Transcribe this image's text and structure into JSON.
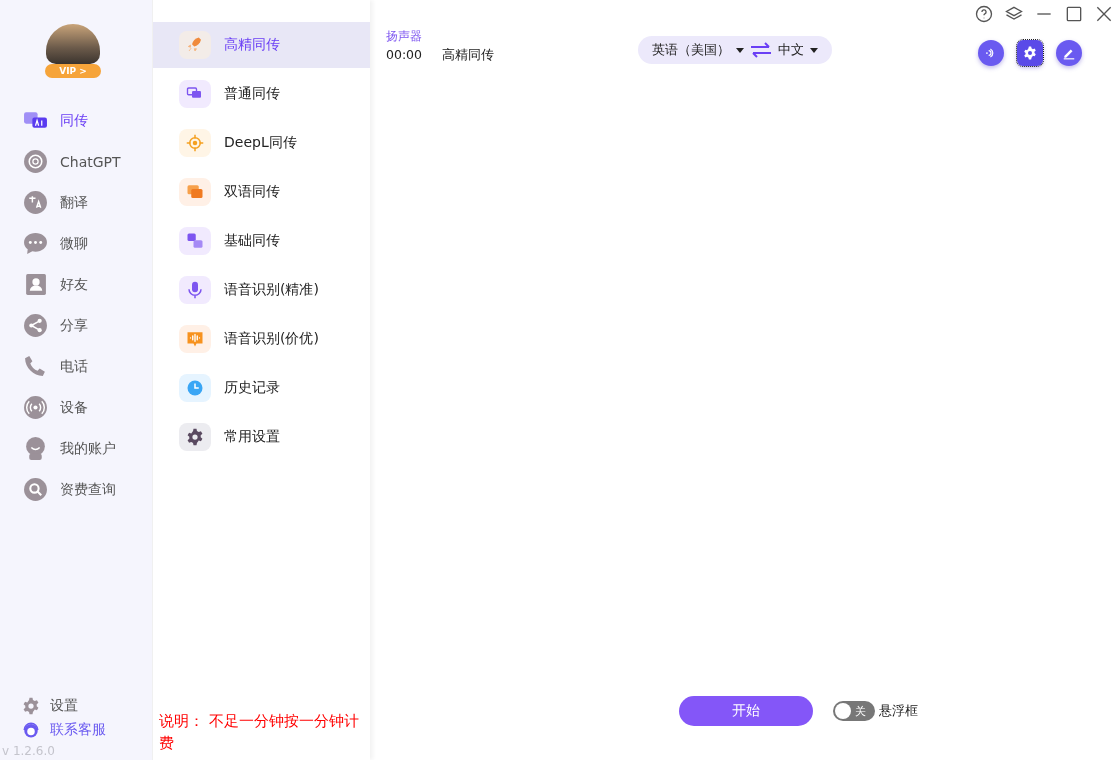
{
  "profile": {
    "badge": "VIP >"
  },
  "nav": {
    "items": [
      {
        "label": "同传",
        "selected": true
      },
      {
        "label": "ChatGPT",
        "selected": false
      },
      {
        "label": "翻译",
        "selected": false
      },
      {
        "label": "微聊",
        "selected": false
      },
      {
        "label": "好友",
        "selected": false
      },
      {
        "label": "分享",
        "selected": false
      },
      {
        "label": "电话",
        "selected": false
      },
      {
        "label": "设备",
        "selected": false
      },
      {
        "label": "我的账户",
        "selected": false
      },
      {
        "label": "资费查询",
        "selected": false
      }
    ],
    "settings": "设置",
    "support": "联系客服",
    "version": "v 1.2.6.0"
  },
  "modes": {
    "items": [
      {
        "label": "高精同传",
        "selected": true
      },
      {
        "label": "普通同传",
        "selected": false
      },
      {
        "label": "DeepL同传",
        "selected": false
      },
      {
        "label": "双语同传",
        "selected": false
      },
      {
        "label": "基础同传",
        "selected": false
      },
      {
        "label": "语音识别(精准)",
        "selected": false
      },
      {
        "label": "语音识别(价优)",
        "selected": false
      },
      {
        "label": "历史记录",
        "selected": false
      },
      {
        "label": "常用设置",
        "selected": false
      }
    ],
    "note": "说明： 不足一分钟按一分钟计费"
  },
  "session": {
    "source": "扬声器",
    "time": "00:00",
    "mode": "高精同传"
  },
  "languages": {
    "source": "英语（美国）",
    "target": "中文"
  },
  "controls": {
    "start": "开始",
    "floating_window": {
      "label": "悬浮框",
      "state_text": "关",
      "on": false
    }
  }
}
